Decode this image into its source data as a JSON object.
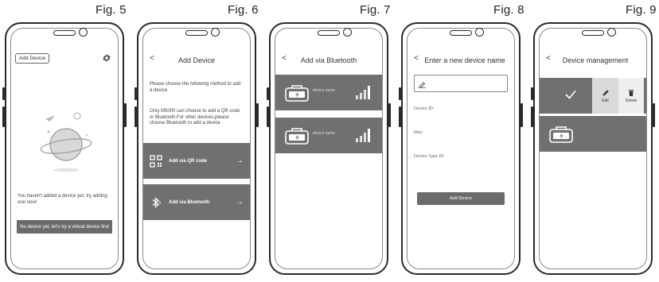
{
  "figures": [
    "Fig. 5",
    "Fig. 6",
    "Fig. 7",
    "Fig. 8",
    "Fig. 9"
  ],
  "fig5": {
    "add_device": "Add Device",
    "empty_text": "You haven't added a device yet, try adding one now!",
    "virtual_button": "No device yet, let's try a virtual device first"
  },
  "fig6": {
    "back": "<",
    "title": "Add Device",
    "instruction": "Please choose the following method to add a device",
    "note": "Only M5000 can choose to add a QR code or Bluetooth.For other devices,please choose Bluetooth to add a device",
    "qr_label": "Add via QR code",
    "bt_label": "Add via Bluetooth",
    "arrow": "→"
  },
  "fig7": {
    "back": "<",
    "title": "Add via Bluetooth",
    "devices": [
      {
        "name": "device name"
      },
      {
        "name": "device name"
      }
    ]
  },
  "fig8": {
    "back": "<",
    "title": "Enter a new device name",
    "device_id": "Device ID:",
    "mac": "Mac:",
    "device_type_id": "Device Type ID:",
    "add_button": "Add Device"
  },
  "fig9": {
    "back": "<",
    "title": "Device management",
    "edit": "Edit",
    "delete": "Delete"
  },
  "colors": {
    "row_gray": "#707070",
    "button_gray": "#6b6b6b",
    "edit_bg": "#d9d9d9",
    "delete_bg": "#efefef"
  }
}
